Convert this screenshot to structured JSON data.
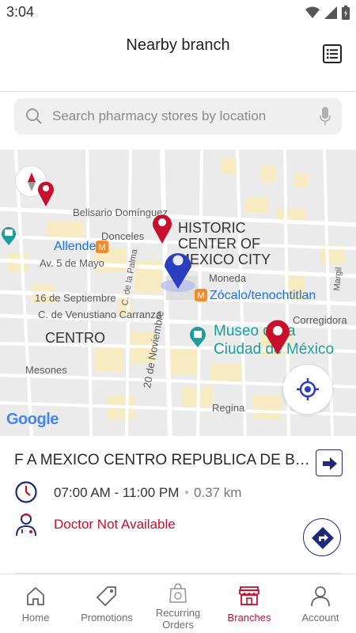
{
  "status_bar": {
    "time": "3:04"
  },
  "header": {
    "title": "Nearby branch",
    "list_icon": "list-view-icon"
  },
  "search": {
    "placeholder": "Search pharmacy stores by location",
    "value": ""
  },
  "map": {
    "labels": {
      "belisario": "Belisario Domínguez",
      "donceles": "Donceles",
      "historic_1": "HISTORIC",
      "historic_2": "CENTER OF",
      "historic_3": "MEXICO CITY",
      "allende": "Allende",
      "av5mayo": "Av. 5 de Mayo",
      "moneda": "Moneda",
      "zocalo": "Zócalo/tenochtitlan",
      "septiembre": "16 de Septiembre",
      "carranza": "C. de Venustiano Carranza",
      "corregidora": "Corregidora",
      "centro": "CENTRO",
      "museo_1": "Museo de la",
      "museo_2": "Ciudad de México",
      "mesones": "Mesones",
      "noviembre": "20 de Noviembre",
      "palma": "C. de la Palma",
      "regina": "Regina",
      "margil": "Margil",
      "google": "Google"
    },
    "colors": {
      "pin_red": "#c8102e",
      "pin_blue": "#2a3fbf",
      "block_yellow": "#f7ebc2"
    }
  },
  "branch": {
    "name": "F A MEXICO CENTRO REPUBLICA DE BRASIL",
    "hours": "07:00 AM - 11:00 PM",
    "separator": "•",
    "distance": "0.37 km",
    "doctor_status": "Doctor Not Available"
  },
  "nav": {
    "items": [
      {
        "label": "Home",
        "icon": "home-icon"
      },
      {
        "label": "Promotions",
        "icon": "tag-icon"
      },
      {
        "label": "Recurring Orders",
        "icon": "shopping-bag-icon"
      },
      {
        "label": "Branches",
        "icon": "store-icon"
      },
      {
        "label": "Account",
        "icon": "person-icon"
      }
    ],
    "active": "Branches",
    "active_color": "#c8102e"
  }
}
